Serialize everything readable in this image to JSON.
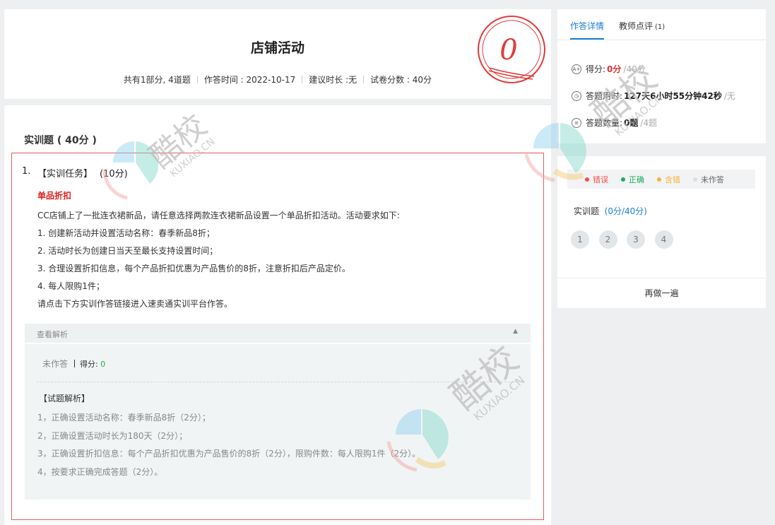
{
  "header": {
    "title": "店铺活动",
    "meta": [
      "共有1部分, 4道题",
      "作答时间 : 2022-10-17",
      "建议时长 :无",
      "试卷分数 : 40分"
    ],
    "stamp_score": "0"
  },
  "section": {
    "title": "实训题 ( 40分 )"
  },
  "question": {
    "number": "1.",
    "title": "【实训任务】",
    "points": "(10分)",
    "subtitle": "单品折扣",
    "lines": [
      "CC店铺上了一批连衣裙新品，请任意选择两款连衣裙新品设置一个单品折扣活动。活动要求如下:",
      "1. 创建新活动并设置活动名称：春季新品8折；",
      "2. 活动时长为创建日当天至最长支持设置时间；",
      "3. 合理设置折扣信息，每个产品折扣优惠为产品售价的8折，注意折扣后产品定价。",
      "4. 每人限购1件；",
      "请点击下方实训作答链接进入速卖通实训平台作答。"
    ]
  },
  "analysis": {
    "toggle_label": "查看解析",
    "caret": "▲",
    "answer_state": "未作答",
    "score_label": "得分: ",
    "score_value": "0",
    "explain_title": "【试题解析】",
    "explain_lines": [
      "1，正确设置活动名称：春季新品8折（2分）；",
      "2，正确设置活动时长为180天（2分）；",
      "3，正确设置折扣信息：每个产品折扣优惠为产品售价的8折（2分），限购件数：每人限购1件（2分）。",
      "4，按要求正确完成答题（2分）。"
    ]
  },
  "side": {
    "tabs": [
      {
        "label": "作答详情"
      },
      {
        "label": "教师点评",
        "count": "(1)"
      }
    ],
    "stats": [
      {
        "icon": "A+",
        "icon_name": "score-icon",
        "label": "得分: ",
        "value": "0分",
        "total": "/40分"
      },
      {
        "icon": "◷",
        "icon_name": "clock-icon",
        "label": "答题用时: ",
        "value": "127天6小时55分钟42秒",
        "total": "/无"
      },
      {
        "icon": "≡",
        "icon_name": "list-icon",
        "label": "答题数量: ",
        "value": "0题",
        "total": "/4题"
      }
    ],
    "legend": [
      {
        "label": "错误",
        "color": "#f05050"
      },
      {
        "label": "正确",
        "color": "#1aad5a"
      },
      {
        "label": "含错",
        "color": "#f5b335"
      },
      {
        "label": "未作答",
        "color": "#dddddd",
        "text_color": "#666666"
      }
    ],
    "part_label": "实训题",
    "part_score": "(0分/40分)",
    "questions": [
      "1",
      "2",
      "3",
      "4"
    ],
    "redo_label": "再做一遍"
  },
  "watermark": {
    "text_main": "酷校",
    "text_sub": "KUXIAO.CN"
  },
  "colors": {
    "accent": "#1a7fd4",
    "error": "#e03030",
    "correct": "#1aad5a"
  }
}
